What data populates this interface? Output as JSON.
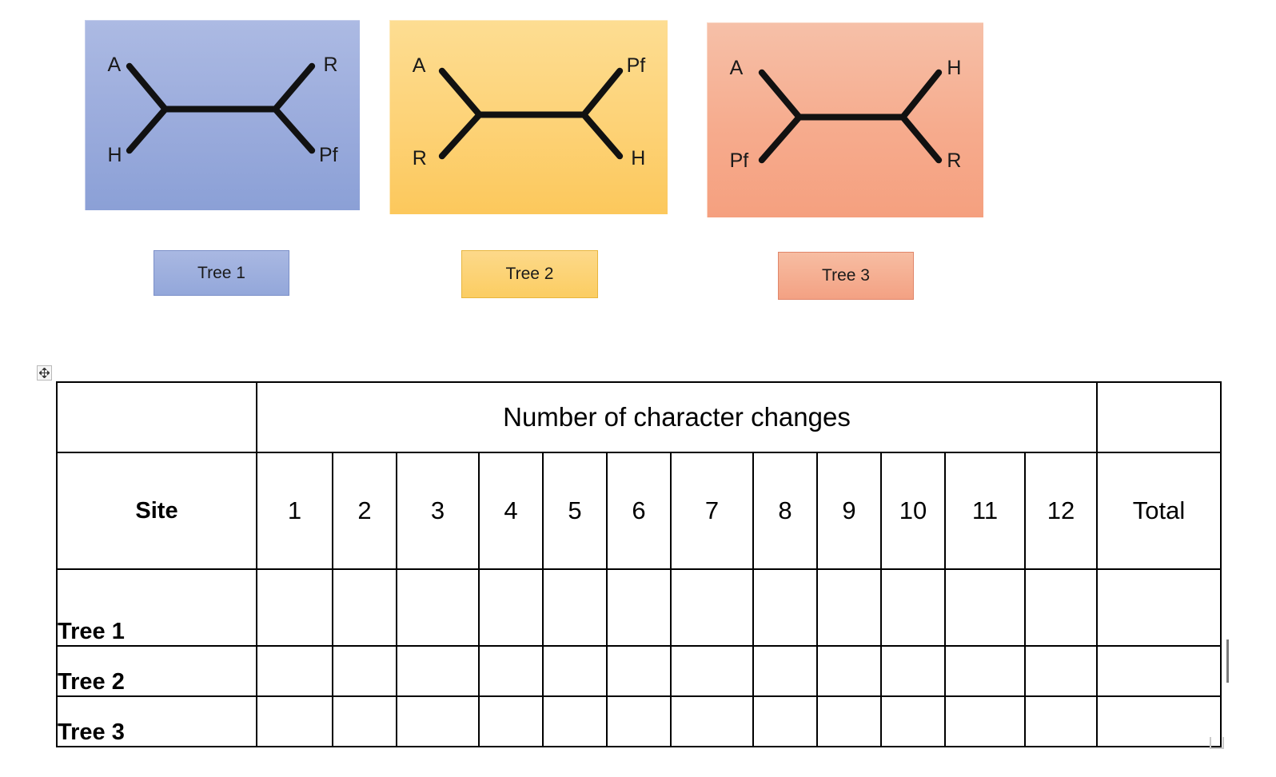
{
  "trees": [
    {
      "id": "tree-1",
      "badge_label": "Tree 1",
      "taxa": {
        "top_left": "A",
        "bottom_left": "H",
        "top_right": "R",
        "bottom_right": "Pf"
      },
      "colors": {
        "fill_top": "#acbae3",
        "fill_bottom": "#8ba0d6",
        "badge_border": "#7b8fc8"
      }
    },
    {
      "id": "tree-2",
      "badge_label": "Tree 2",
      "taxa": {
        "top_left": "A",
        "bottom_left": "R",
        "top_right": "Pf",
        "bottom_right": "H"
      },
      "colors": {
        "fill_top": "#fddd92",
        "fill_bottom": "#fcc85c",
        "badge_border": "#e8b63e"
      }
    },
    {
      "id": "tree-3",
      "badge_label": "Tree 3",
      "taxa": {
        "top_left": "A",
        "bottom_left": "Pf",
        "top_right": "H",
        "bottom_right": "R"
      },
      "colors": {
        "fill_top": "#f6c0a8",
        "fill_bottom": "#f5a07f",
        "badge_border": "#e0866a"
      }
    }
  ],
  "table": {
    "span_header": "Number of character changes",
    "corner_header": "",
    "total_corner_header": "",
    "site_header": "Site",
    "site_columns": [
      "1",
      "2",
      "3",
      "4",
      "5",
      "6",
      "7",
      "8",
      "9",
      "10",
      "11",
      "12"
    ],
    "total_header": "Total",
    "rows": [
      {
        "label": "Tree 1",
        "values": [
          "",
          "",
          "",
          "",
          "",
          "",
          "",
          "",
          "",
          "",
          "",
          ""
        ],
        "total": ""
      },
      {
        "label": "Tree 2",
        "values": [
          "",
          "",
          "",
          "",
          "",
          "",
          "",
          "",
          "",
          "",
          "",
          ""
        ],
        "total": ""
      },
      {
        "label": "Tree 3",
        "values": [
          "",
          "",
          "",
          "",
          "",
          "",
          "",
          "",
          "",
          "",
          "",
          ""
        ],
        "total": ""
      }
    ]
  },
  "chrome": {
    "move_handle_icon": "move-cross-icon",
    "resize_handle_icon": "resize-corner-icon",
    "caret_icon": "text-caret"
  }
}
